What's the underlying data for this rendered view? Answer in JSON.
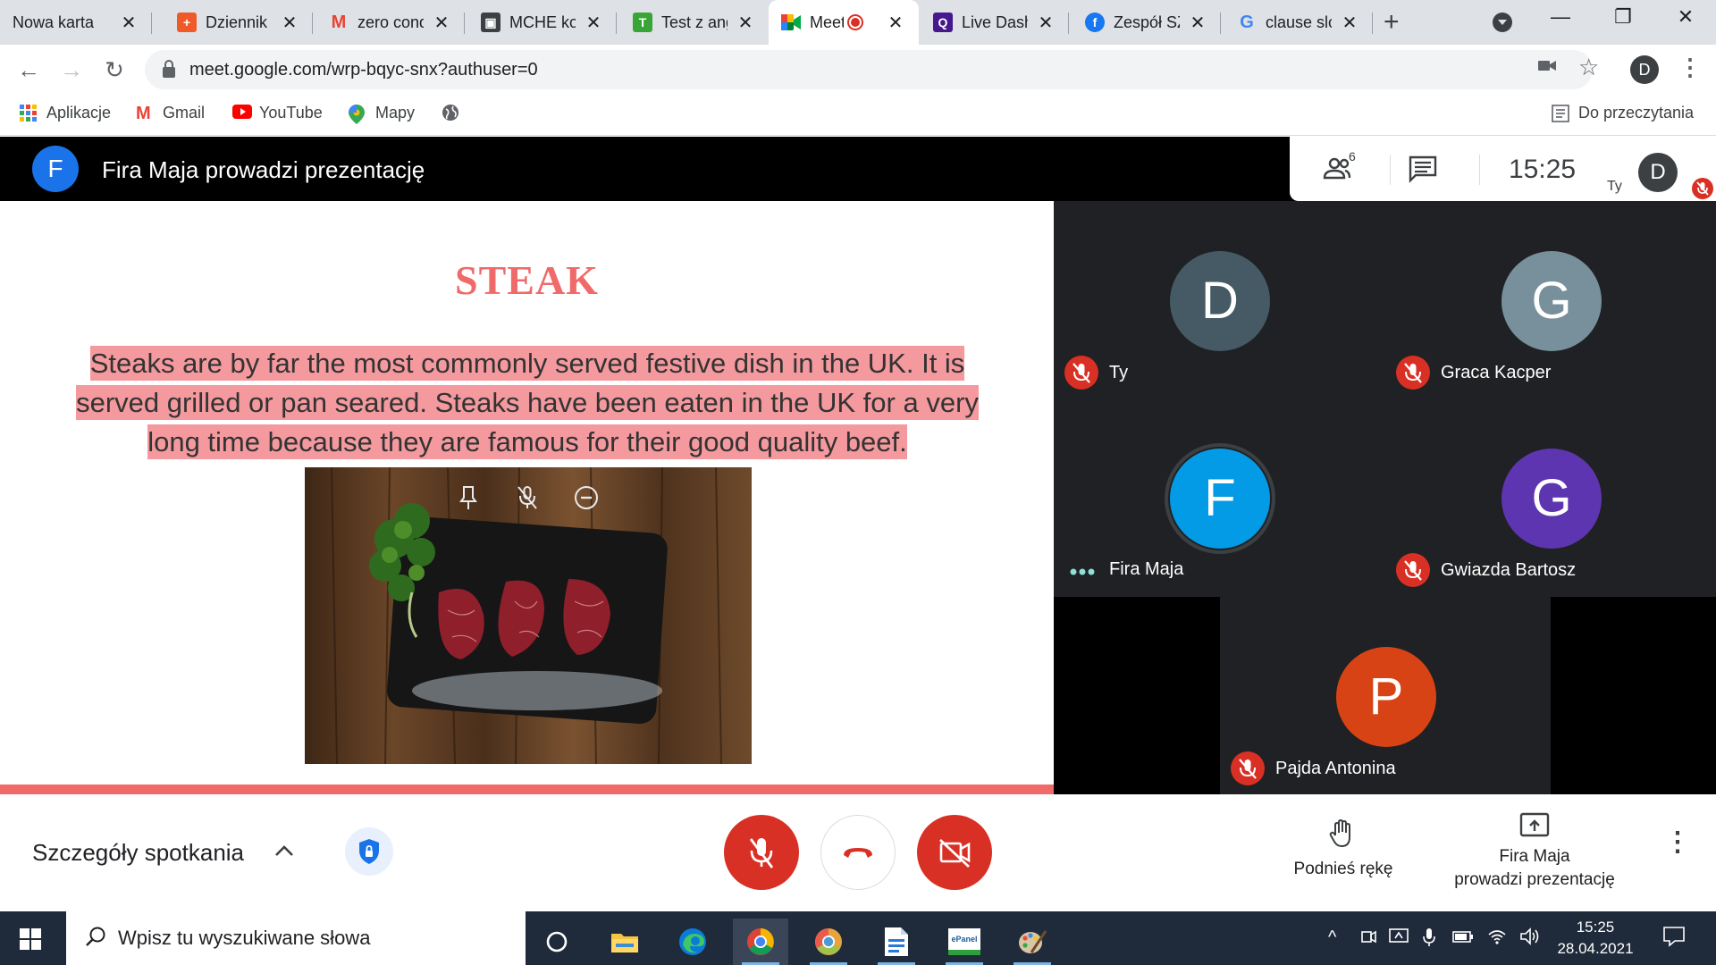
{
  "browser": {
    "tabs": [
      {
        "label": "Nowa karta",
        "icon": "none",
        "color": "#dee1e6"
      },
      {
        "label": "Dziennik",
        "icon": "dziennik-icon",
        "color": "#f05a28"
      },
      {
        "label": "zero condi",
        "icon": "gmail-icon",
        "color": "#ea4335"
      },
      {
        "label": "MCHE kon",
        "icon": "classroom-icon",
        "color": "#3c4043"
      },
      {
        "label": "Test z ang",
        "icon": "testportal-icon",
        "color": "#3aa537"
      },
      {
        "label": "Meet",
        "icon": "meet-icon",
        "color": "#00832d"
      },
      {
        "label": "Live Dash",
        "icon": "quizizz-icon",
        "color": "#8854c0"
      },
      {
        "label": "Zespół SZ",
        "icon": "facebook-icon",
        "color": "#1877f2"
      },
      {
        "label": "clause slow",
        "icon": "google-icon",
        "color": "#4285f4"
      }
    ],
    "url": "meet.google.com/wrp-bqyc-snx?authuser=0",
    "profile_initial": "D",
    "bookmarks": [
      {
        "label": "Aplikacje",
        "icon": "apps-grid-icon"
      },
      {
        "label": "Gmail",
        "icon": "gmail-icon"
      },
      {
        "label": "YouTube",
        "icon": "youtube-icon"
      },
      {
        "label": "Mapy",
        "icon": "maps-pin-icon"
      },
      {
        "label": "",
        "icon": "globe-icon"
      }
    ],
    "reading_list": "Do przeczytania"
  },
  "meet": {
    "presenter_initial": "F",
    "presenter_title": "Fira Maja prowadzi prezentację",
    "people_count": "6",
    "clock": "15:25",
    "you_label": "Ty",
    "you_initial": "D",
    "slide": {
      "title": "STEAK",
      "text": "Steaks are by far the most commonly served festive dish in the UK. It is served grilled or pan seared. Steaks have been eaten in the UK for a very long time because they are famous for their good quality beef."
    },
    "participants": [
      {
        "name": "Ty",
        "initial": "D",
        "color": "#455a64",
        "muted": true
      },
      {
        "name": "Graca Kacper",
        "initial": "G",
        "color": "#78909c",
        "muted": true
      },
      {
        "name": "Fira Maja",
        "initial": "F",
        "color": "#039be5",
        "muted": false,
        "speaking": true
      },
      {
        "name": "Gwiazda Bartosz",
        "initial": "G",
        "color": "#5e35b1",
        "muted": true
      },
      {
        "name": "Pajda Antonina",
        "initial": "P",
        "color": "#d84315",
        "muted": true
      }
    ],
    "controls": {
      "meeting_details": "Szczegóły spotkania",
      "raise_hand": "Podnieś rękę",
      "presenting_line1": "Fira Maja",
      "presenting_line2": "prowadzi prezentację"
    },
    "accent_red": "#d93025"
  },
  "taskbar": {
    "search_placeholder": "Wpisz tu wyszukiwane słowa",
    "time": "15:25",
    "date": "28.04.2021",
    "apps": [
      "cortana-icon",
      "file-explorer-icon",
      "edge-icon",
      "chrome-icon",
      "chrome-canary-icon",
      "document-icon",
      "epanel-icon",
      "paint-icon"
    ],
    "epanel_label": "ePanel"
  }
}
